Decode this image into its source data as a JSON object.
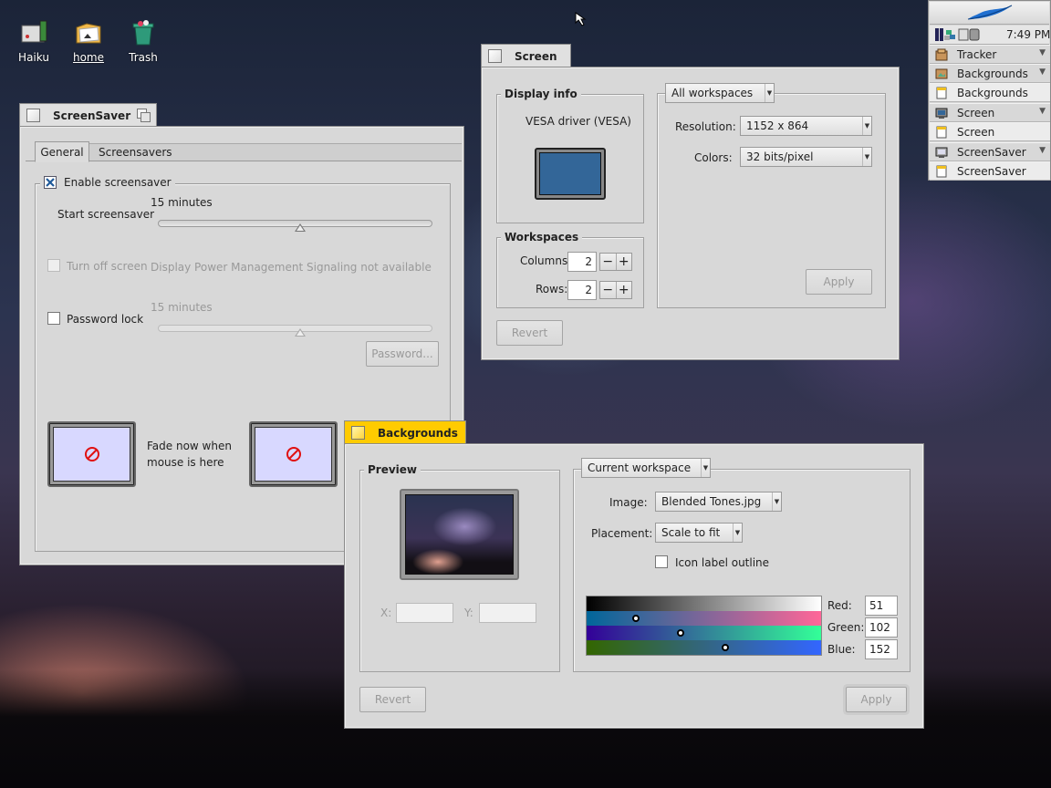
{
  "desktop": {
    "icons": [
      {
        "label": "Haiku"
      },
      {
        "label": "home"
      },
      {
        "label": "Trash"
      }
    ]
  },
  "deskbar": {
    "clock": "7:49 PM",
    "items": [
      {
        "label": "Tracker",
        "icon": "tracker-icon"
      },
      {
        "label": "Backgrounds",
        "icon": "backgrounds-app-icon"
      },
      {
        "label": "Backgrounds",
        "icon": "window-icon"
      },
      {
        "label": "Screen",
        "icon": "screen-app-icon"
      },
      {
        "label": "Screen",
        "icon": "window-icon"
      },
      {
        "label": "ScreenSaver",
        "icon": "screensaver-app-icon"
      },
      {
        "label": "ScreenSaver",
        "icon": "window-icon"
      }
    ]
  },
  "screensaver": {
    "title": "ScreenSaver",
    "tabs": [
      "General",
      "Screensavers"
    ],
    "enable_label": "Enable screensaver",
    "start_value": "15 minutes",
    "start_label": "Start screensaver",
    "turnoff_label": "Turn off screen",
    "dpms_note": "Display Power Management Signaling not available",
    "password_value": "15 minutes",
    "password_label": "Password lock",
    "password_button": "Password...",
    "fade_text_line1": "Fade now when",
    "fade_text_line2": "mouse is here"
  },
  "screen": {
    "title": "Screen",
    "display_info_label": "Display info",
    "driver": "VESA driver (VESA)",
    "workspaces_label": "Workspaces",
    "columns_label": "Columns:",
    "columns_value": "2",
    "rows_label": "Rows:",
    "rows_value": "2",
    "workspace_menu": "All workspaces",
    "resolution_label": "Resolution:",
    "resolution_value": "1152 x 864",
    "colors_label": "Colors:",
    "colors_value": "32 bits/pixel",
    "apply_label": "Apply",
    "revert_label": "Revert",
    "monitor_color": "#336698"
  },
  "backgrounds": {
    "title": "Backgrounds",
    "preview_label": "Preview",
    "x_label": "X:",
    "y_label": "Y:",
    "workspace_menu": "Current workspace",
    "image_label": "Image:",
    "image_value": "Blended Tones.jpg",
    "placement_label": "Placement:",
    "placement_value": "Scale to fit",
    "icon_outline_label": "Icon label outline",
    "red_label": "Red:",
    "red_value": "51",
    "green_label": "Green:",
    "green_value": "102",
    "blue_label": "Blue:",
    "blue_value": "152",
    "revert_label": "Revert",
    "apply_label": "Apply"
  }
}
